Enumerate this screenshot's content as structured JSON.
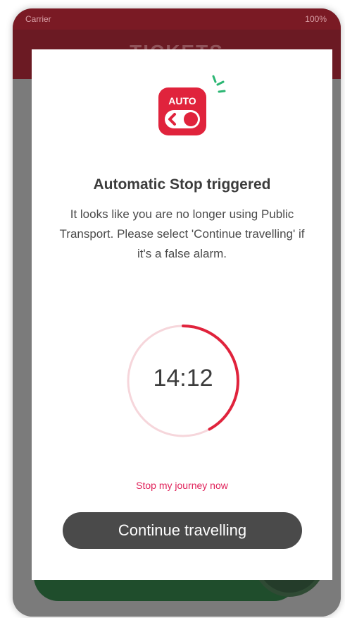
{
  "status_bar": {
    "carrier": "Carrier",
    "time": "",
    "battery": "100%"
  },
  "app_header": {
    "title": "TICKETS"
  },
  "modal": {
    "icon": {
      "name": "auto-stop-icon",
      "label": "AUTO",
      "color": "#e0233c"
    },
    "title": "Automatic Stop triggered",
    "message": "It looks like you are no longer using Public Transport. Please select 'Continue travelling' if it's a false alarm.",
    "timer": {
      "value": "14:12",
      "progress_fraction": 0.42,
      "ring_color": "#e0233c"
    },
    "stop_link": "Stop my journey now",
    "continue_button": "Continue travelling"
  },
  "colors": {
    "accent": "#e0233c",
    "link": "#e0225a",
    "button": "#4a4a4a",
    "header": "#6b1a23"
  }
}
